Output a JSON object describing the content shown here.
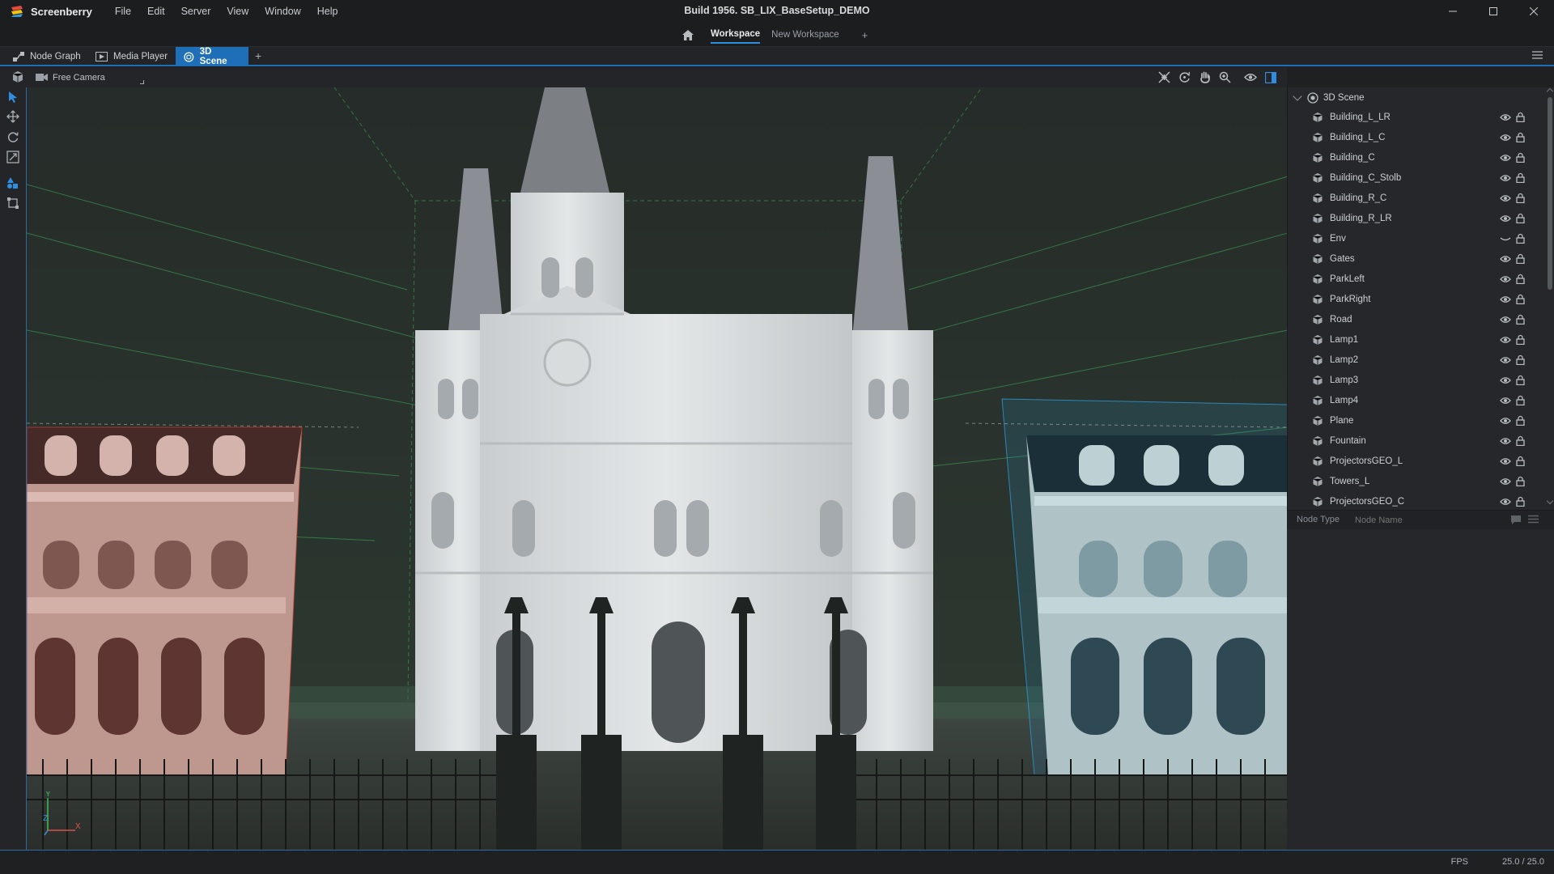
{
  "app": {
    "name": "Screenberry",
    "build_title": "Build 1956. SB_LIX_BaseSetup_DEMO"
  },
  "menu": [
    "File",
    "Edit",
    "Server",
    "View",
    "Window",
    "Help"
  ],
  "workspaces": {
    "tabs": [
      {
        "label": "Workspace",
        "active": true
      },
      {
        "label": "New Workspace",
        "active": false
      }
    ],
    "add_label": "+"
  },
  "panel_tabs": [
    {
      "label": "Node Graph",
      "icon": "node-graph-icon",
      "active": false
    },
    {
      "label": "Media Player",
      "icon": "media-player-icon",
      "active": false
    },
    {
      "label": "3D Scene",
      "icon": "scene-cube-icon",
      "active": true
    }
  ],
  "panel_add_label": "+",
  "viewport": {
    "camera": "Free Camera",
    "axes": {
      "y": "Y",
      "z": "Z",
      "x": "X"
    }
  },
  "outliner": {
    "root": "3D Scene",
    "nodes": [
      {
        "name": "Building_L_LR",
        "visible": true
      },
      {
        "name": "Building_L_C",
        "visible": true
      },
      {
        "name": "Building_C",
        "visible": true
      },
      {
        "name": "Building_C_Stolb",
        "visible": true
      },
      {
        "name": "Building_R_C",
        "visible": true
      },
      {
        "name": "Building_R_LR",
        "visible": true
      },
      {
        "name": "Env",
        "visible": false
      },
      {
        "name": "Gates",
        "visible": true
      },
      {
        "name": "ParkLeft",
        "visible": true
      },
      {
        "name": "ParkRight",
        "visible": true
      },
      {
        "name": "Road",
        "visible": true
      },
      {
        "name": "Lamp1",
        "visible": true
      },
      {
        "name": "Lamp2",
        "visible": true
      },
      {
        "name": "Lamp3",
        "visible": true
      },
      {
        "name": "Lamp4",
        "visible": true
      },
      {
        "name": "Plane",
        "visible": true
      },
      {
        "name": "Fountain",
        "visible": true
      },
      {
        "name": "ProjectorsGEO_L",
        "visible": true
      },
      {
        "name": "Towers_L",
        "visible": true
      },
      {
        "name": "ProjectorsGEO_C",
        "visible": true
      }
    ]
  },
  "search": {
    "node_type_label": "Node Type",
    "node_name_placeholder": "Node Name"
  },
  "status": {
    "fps_label": "FPS",
    "fps_value": "25.0 / 25.0"
  },
  "colors": {
    "accent": "#1f6fb8",
    "selection_left": "#c0392b",
    "selection_right": "#2e9ad6",
    "frustum_green": "#3fae5a"
  }
}
